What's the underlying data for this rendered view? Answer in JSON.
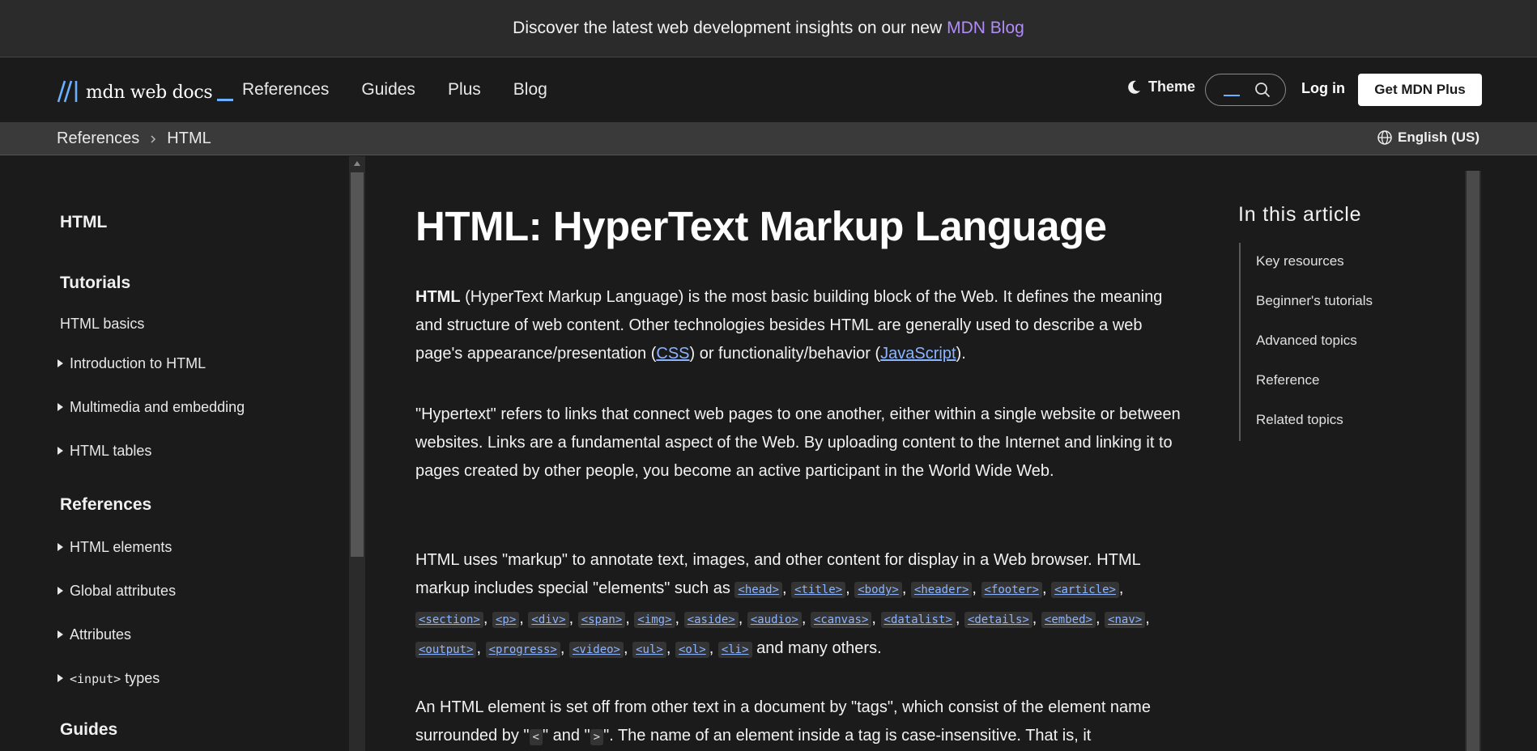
{
  "banner": {
    "text": "Discover the latest web development insights on our new",
    "link": "MDN Blog"
  },
  "header": {
    "logo_text": "mdn web docs",
    "nav": [
      "References",
      "Guides",
      "Plus",
      "Blog"
    ],
    "theme_label": "Theme",
    "login_label": "Log in",
    "cta_label": "Get MDN Plus"
  },
  "breadcrumb": {
    "items": [
      "References",
      "HTML"
    ],
    "language": "English (US)"
  },
  "sidebar": {
    "items": [
      {
        "label": "HTML",
        "kind": "heading"
      },
      {
        "label": "Tutorials",
        "kind": "heading"
      },
      {
        "label": "HTML basics",
        "kind": "link"
      },
      {
        "label": "Introduction to HTML",
        "kind": "expandable"
      },
      {
        "label": "Multimedia and embedding",
        "kind": "expandable"
      },
      {
        "label": "HTML tables",
        "kind": "expandable"
      },
      {
        "label": "References",
        "kind": "heading"
      },
      {
        "label": "HTML elements",
        "kind": "expandable"
      },
      {
        "label": "Global attributes",
        "kind": "expandable"
      },
      {
        "label": "Attributes",
        "kind": "expandable"
      },
      {
        "label": "<input>",
        "suffix": " types",
        "kind": "expandable"
      },
      {
        "label": "Guides",
        "kind": "heading"
      }
    ]
  },
  "article": {
    "title": "HTML: HyperText Markup Language",
    "p1": {
      "strong": "HTML",
      "text1": " (HyperText Markup Language) is the most basic building block of the Web. It defines the meaning and structure of web content. Other technologies besides HTML are generally used to describe a web page's appearance/presentation (",
      "link1": "CSS",
      "text2": ") or functionality/behavior (",
      "link2": "JavaScript",
      "text3": ")."
    },
    "p2": "\"Hypertext\" refers to links that connect web pages to one another, either within a single website or between websites. Links are a fundamental aspect of the Web. By uploading content to the Internet and linking it to pages created by other people, you become an active participant in the World Wide Web.",
    "p3": {
      "text1": "HTML uses \"markup\" to annotate text, images, and other content for display in a Web browser. HTML markup includes special \"elements\" such as ",
      "tags": [
        "<head>",
        "<title>",
        "<body>",
        "<header>",
        "<footer>",
        "<article>",
        "<section>",
        "<p>",
        "<div>",
        "<span>",
        "<img>",
        "<aside>",
        "<audio>",
        "<canvas>",
        "<datalist>",
        "<details>",
        "<embed>",
        "<nav>",
        "<output>",
        "<progress>",
        "<video>",
        "<ul>",
        "<ol>",
        "<li>"
      ],
      "text2": " and many others."
    },
    "p4": {
      "text1": "An HTML element is set off from other text in a document by \"tags\", which consist of the element name surrounded by \"",
      "code1": "<",
      "text2": "\" and \"",
      "code2": ">",
      "text3": "\". The name of an element inside a tag is case-insensitive. That is, it"
    }
  },
  "toc": {
    "title": "In this article",
    "items": [
      "Key resources",
      "Beginner's tutorials",
      "Advanced topics",
      "Reference",
      "Related topics"
    ]
  },
  "colors": {
    "background": "#1b1b1b",
    "banner": "#2b2b2b",
    "link": "#8cb4ff",
    "blog_link": "#b18cf7",
    "logo_accent": "#6ab0ff"
  }
}
